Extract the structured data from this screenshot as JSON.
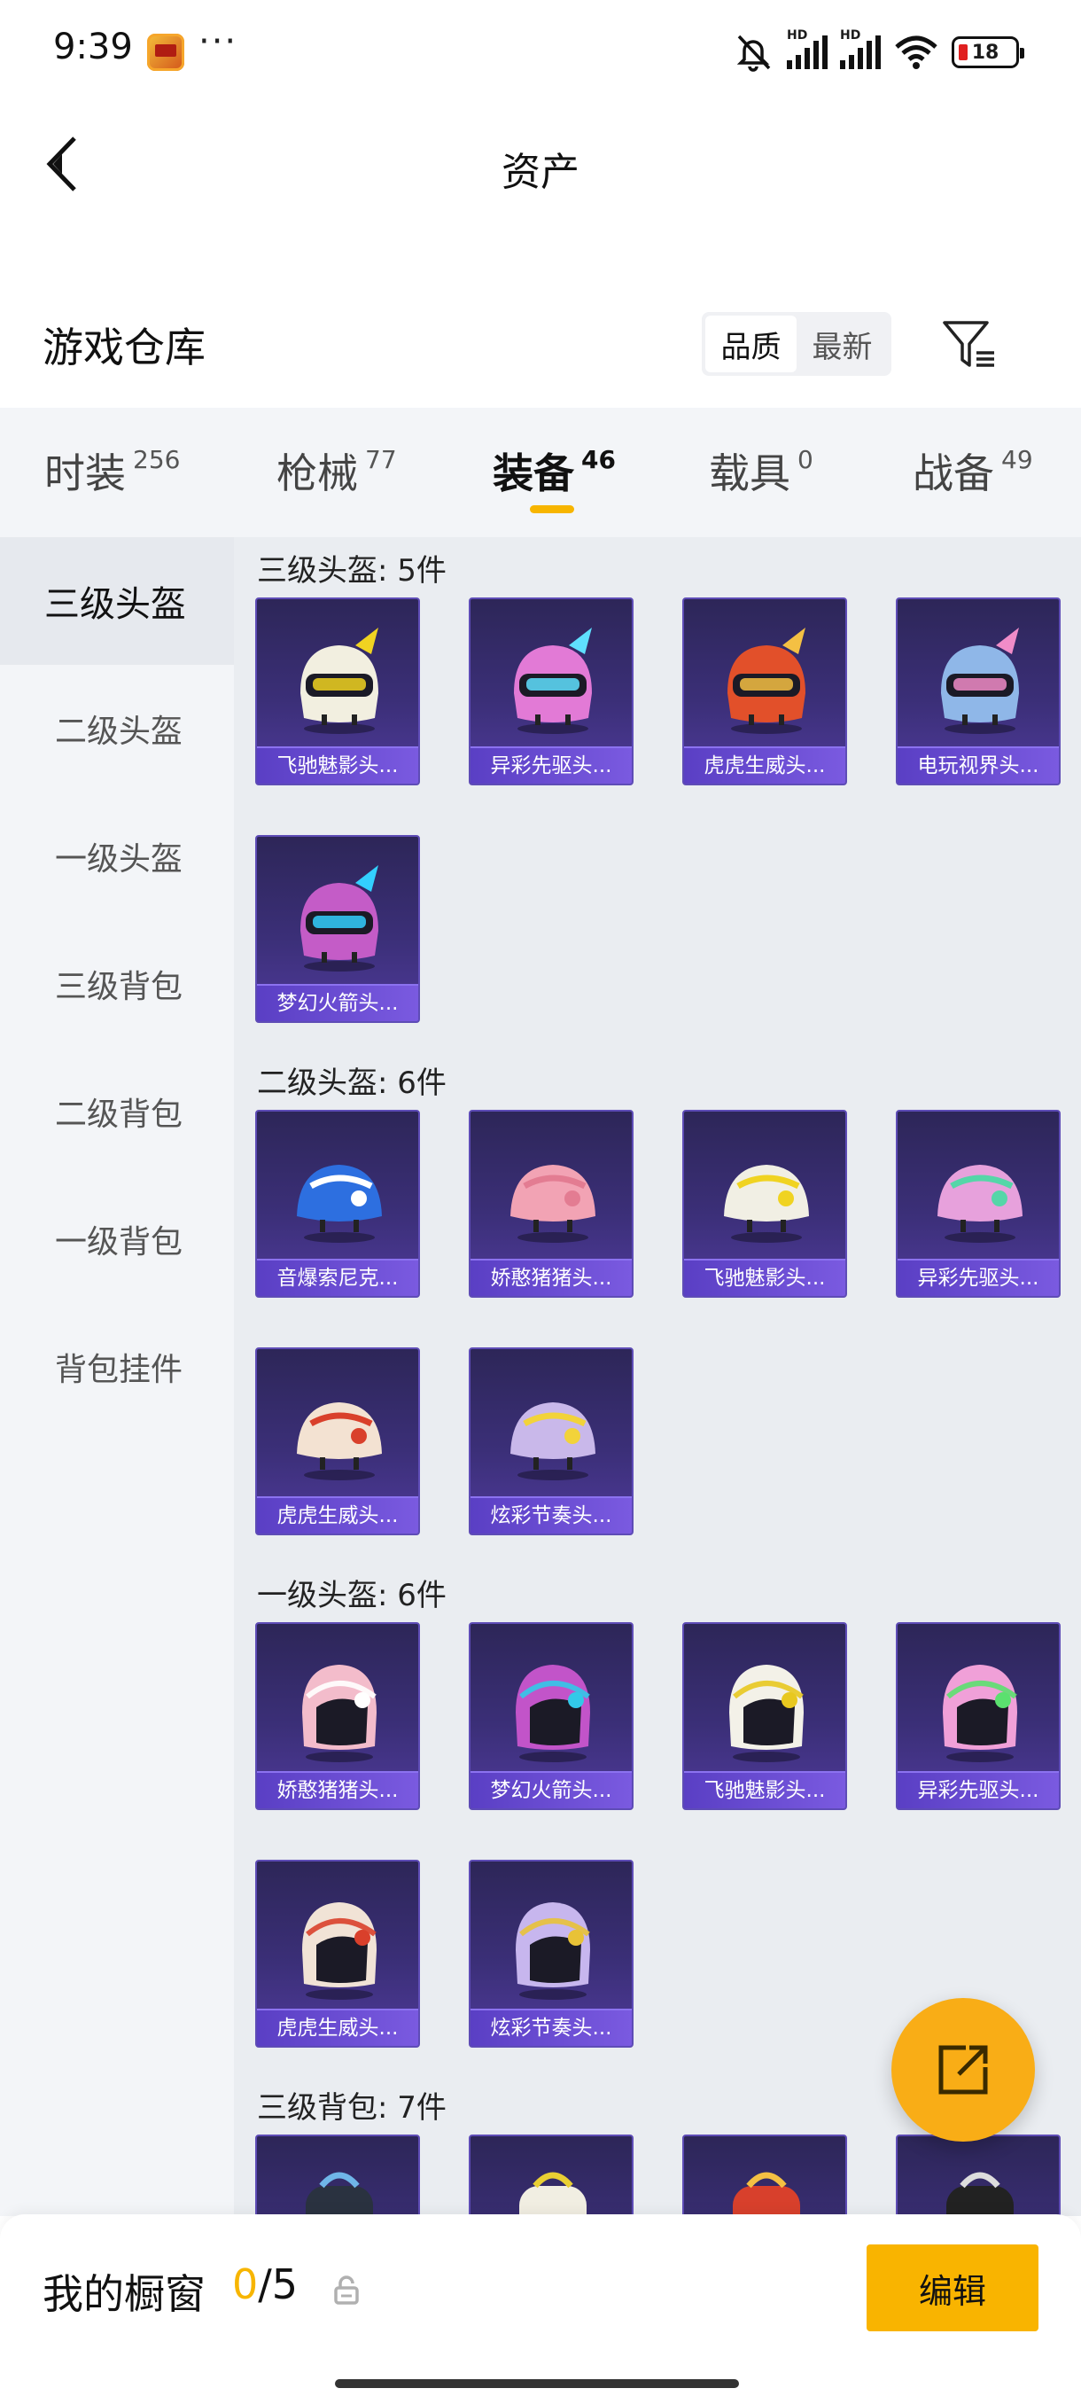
{
  "status_bar": {
    "time": "9:39",
    "dots": "···",
    "battery": "18",
    "signal_tag": "HD"
  },
  "header": {
    "title": "资产"
  },
  "warehouse": {
    "title": "游戏仓库",
    "sort_options": [
      "品质",
      "最新"
    ],
    "active_sort": "品质"
  },
  "tabs": [
    {
      "label": "时装",
      "count": "256"
    },
    {
      "label": "枪械",
      "count": "77"
    },
    {
      "label": "装备",
      "count": "46"
    },
    {
      "label": "载具",
      "count": "0"
    },
    {
      "label": "战备",
      "count": "49"
    }
  ],
  "active_tab": "装备",
  "sidebar": {
    "items": [
      "三级头盔",
      "二级头盔",
      "一级头盔",
      "三级背包",
      "二级背包",
      "一级背包",
      "背包挂件"
    ],
    "active": "三级头盔"
  },
  "sections": [
    {
      "title": "三级头盔: 5件",
      "items": [
        {
          "name": "飞驰魅影头...",
          "kind": "helmet-visor",
          "color": "#f2efe0",
          "accent": "#f0d321"
        },
        {
          "name": "异彩先驱头...",
          "kind": "helmet-visor",
          "color": "#e27ad6",
          "accent": "#5fe0ff"
        },
        {
          "name": "虎虎生威头...",
          "kind": "helmet-visor",
          "color": "#e2502a",
          "accent": "#f4c043"
        },
        {
          "name": "电玩视界头...",
          "kind": "helmet-visor",
          "color": "#8fb7e8",
          "accent": "#f08cc8"
        },
        {
          "name": "梦幻火箭头...",
          "kind": "helmet-visor",
          "color": "#c45cc7",
          "accent": "#33d0ff"
        }
      ]
    },
    {
      "title": "二级头盔: 6件",
      "items": [
        {
          "name": "音爆索尼克...",
          "kind": "helmet-cap",
          "color": "#2d6fe0",
          "accent": "#ffffff"
        },
        {
          "name": "娇憨猪猪头...",
          "kind": "helmet-cap",
          "color": "#f2a3b4",
          "accent": "#e37c92"
        },
        {
          "name": "飞驰魅影头...",
          "kind": "helmet-cap",
          "color": "#f1efe4",
          "accent": "#f0d321"
        },
        {
          "name": "异彩先驱头...",
          "kind": "helmet-cap",
          "color": "#e7a1dc",
          "accent": "#55d6a8"
        },
        {
          "name": "虎虎生威头...",
          "kind": "helmet-cap",
          "color": "#f3e2d2",
          "accent": "#d9402b"
        },
        {
          "name": "炫彩节奏头...",
          "kind": "helmet-cap",
          "color": "#c9b8ea",
          "accent": "#f2d33a"
        }
      ]
    },
    {
      "title": "一级头盔: 6件",
      "items": [
        {
          "name": "娇憨猪猪头...",
          "kind": "helmet-full",
          "color": "#f3bccb",
          "accent": "#ffffff"
        },
        {
          "name": "梦幻火箭头...",
          "kind": "helmet-full",
          "color": "#c254c9",
          "accent": "#32c9e8"
        },
        {
          "name": "飞驰魅影头...",
          "kind": "helmet-full",
          "color": "#f3f1e8",
          "accent": "#e8c81f"
        },
        {
          "name": "异彩先驱头...",
          "kind": "helmet-full",
          "color": "#f0a0d8",
          "accent": "#5be06f"
        },
        {
          "name": "虎虎生威头...",
          "kind": "helmet-full",
          "color": "#f1e3d6",
          "accent": "#d9402b"
        },
        {
          "name": "炫彩节奏头...",
          "kind": "helmet-full",
          "color": "#c7b6ee",
          "accent": "#e8c237"
        }
      ]
    },
    {
      "title": "三级背包: 7件",
      "items": [
        {
          "name": "",
          "kind": "backpack",
          "color": "#2a3240",
          "accent": "#6fb6e8"
        },
        {
          "name": "",
          "kind": "backpack",
          "color": "#f1eee2",
          "accent": "#e9cf33"
        },
        {
          "name": "",
          "kind": "backpack",
          "color": "#d8402c",
          "accent": "#f4c043"
        },
        {
          "name": "",
          "kind": "backpack",
          "color": "#222222",
          "accent": "#dddddd"
        }
      ]
    }
  ],
  "bottom": {
    "showcase_label": "我的橱窗",
    "showcase_used": "0",
    "showcase_total": "/5",
    "edit_label": "编辑"
  }
}
